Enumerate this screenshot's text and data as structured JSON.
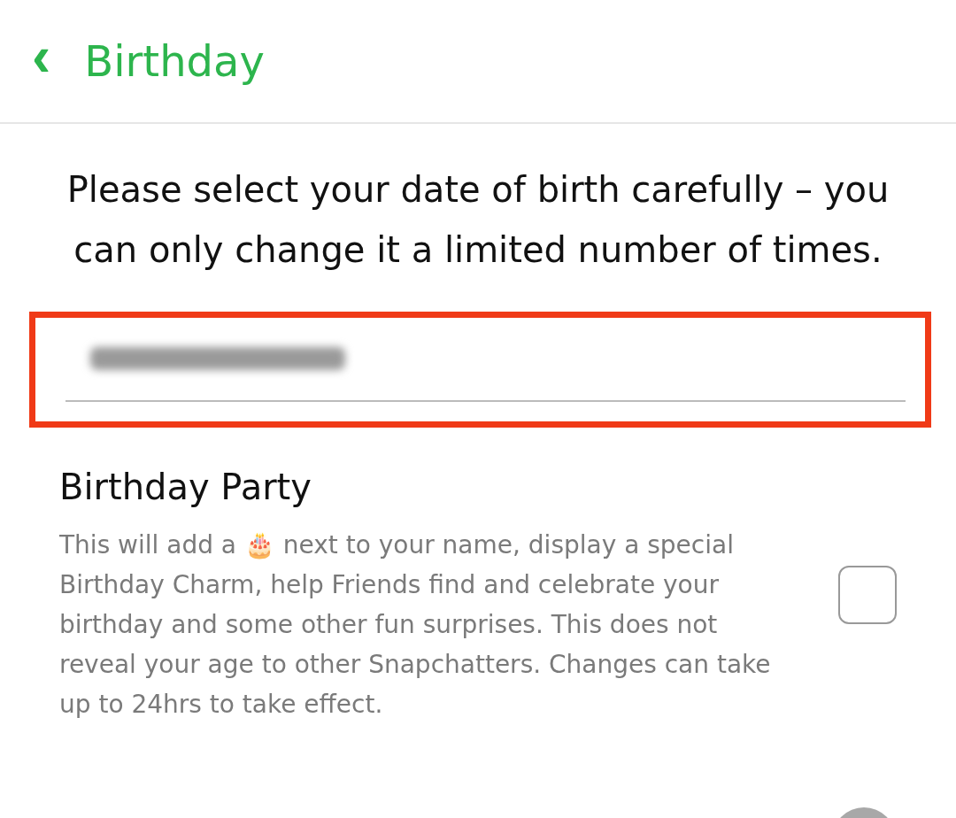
{
  "header": {
    "back": "‹",
    "title": "Birthday"
  },
  "instruction": "Please select your date of birth carefully – you can only change it a limited number of times.",
  "date_field": {
    "highlighted": true
  },
  "party": {
    "title": "Birthday Party",
    "description": "This will add a 🎂 next to your name, display a special Birthday Charm, help Friends find and celebrate your birthday and some other fun surprises. This does not reveal your age to other Snapchatters. Changes can take up to 24hrs to take effect.",
    "checked": false
  }
}
